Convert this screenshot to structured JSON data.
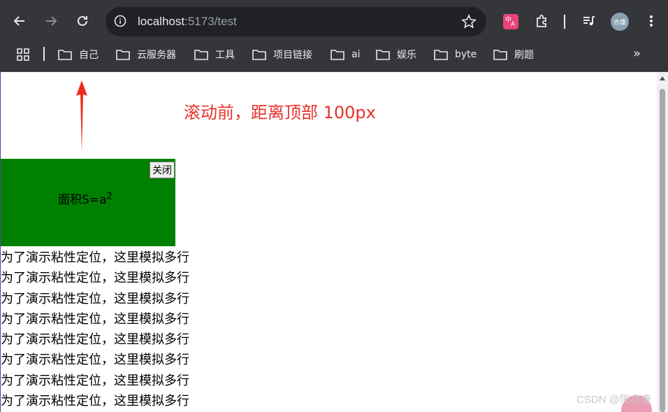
{
  "browser": {
    "url_host": "localhost",
    "url_rest": ":5173/test",
    "avatar_text": "亦康",
    "translate_ext_text_top": "中",
    "translate_ext_text_bottom": "A"
  },
  "bookmarks": [
    {
      "label": "自己"
    },
    {
      "label": "云服务器"
    },
    {
      "label": "工具"
    },
    {
      "label": "项目链接"
    },
    {
      "label": "ai"
    },
    {
      "label": "娱乐"
    },
    {
      "label": "byte"
    },
    {
      "label": "刷题"
    }
  ],
  "page": {
    "annotation": "滚动前，距离顶部 100px",
    "area_label": "面积S=a",
    "area_exponent": "2",
    "close_button": "关闭",
    "lines": [
      "为了演示粘性定位，这里模拟多行",
      "为了演示粘性定位，这里模拟多行",
      "为了演示粘性定位，这里模拟多行",
      "为了演示粘性定位，这里模拟多行",
      "为了演示粘性定位，这里模拟多行",
      "为了演示粘性定位，这里模拟多行",
      "为了演示粘性定位，这里模拟多行",
      "为了演示粘性定位，这里模拟多行"
    ],
    "watermark": "CSDN @陈亦康"
  },
  "colors": {
    "chrome_bg": "#35363a",
    "omnibox_bg": "#202124",
    "box_green": "#008000",
    "annotation_red": "#e8322a"
  }
}
